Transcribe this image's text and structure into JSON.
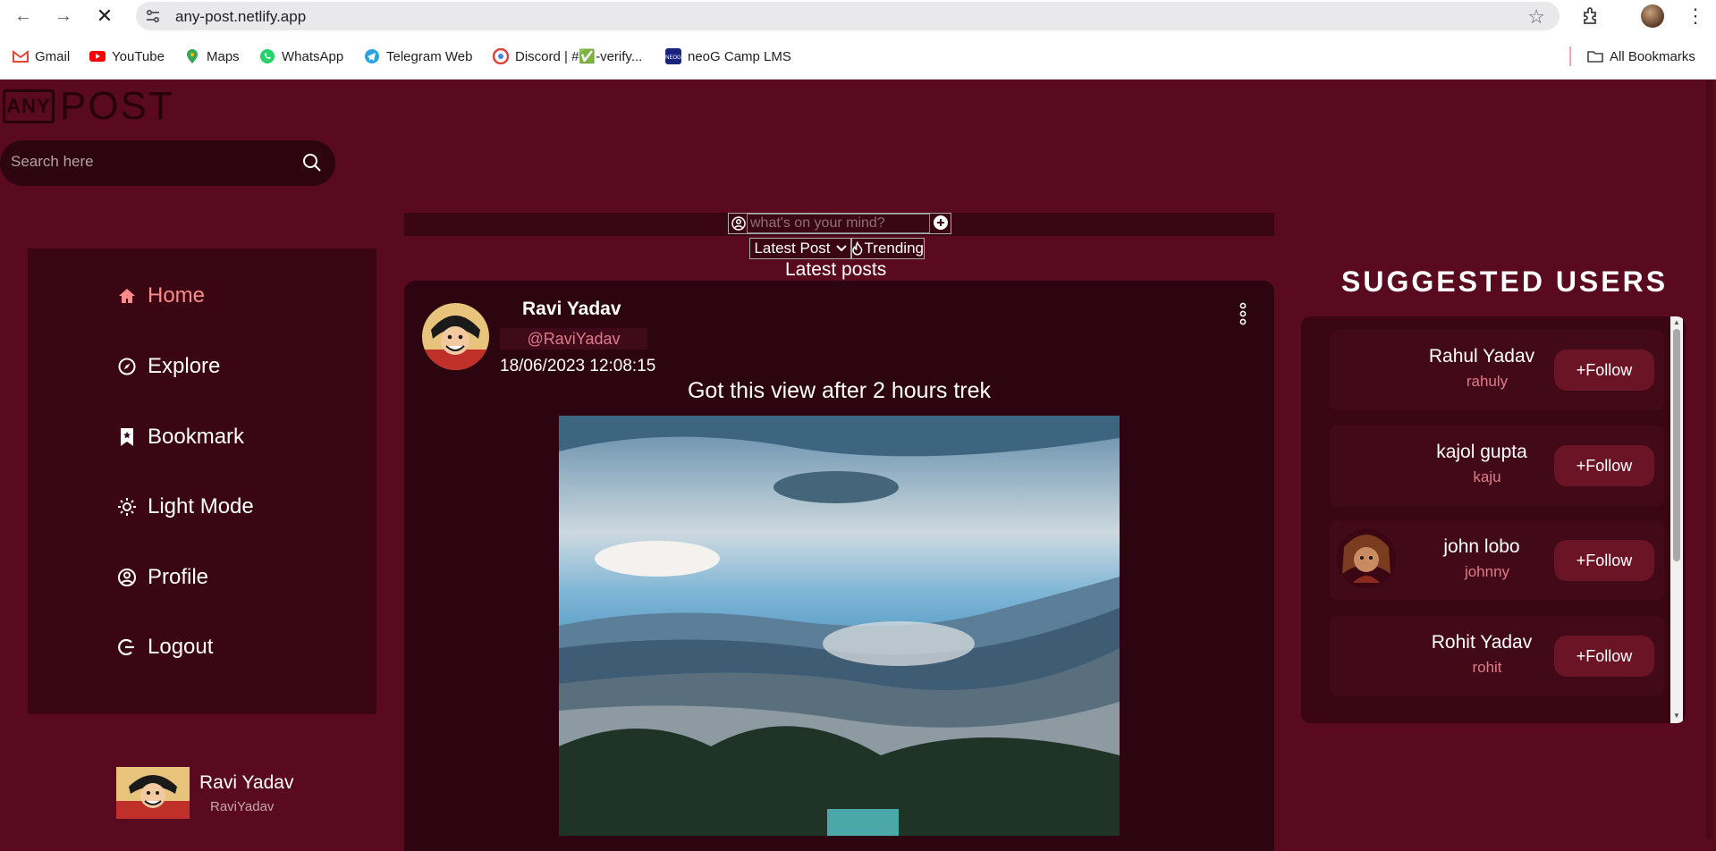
{
  "browser": {
    "url": "any-post.netlify.app",
    "bookmarks": [
      {
        "label": "Gmail",
        "icon": "gmail-icon",
        "color": "#ea4335"
      },
      {
        "label": "YouTube",
        "icon": "youtube-icon",
        "color": "#ff0000"
      },
      {
        "label": "Maps",
        "icon": "maps-icon",
        "color": "#34a853"
      },
      {
        "label": "WhatsApp",
        "icon": "whatsapp-icon",
        "color": "#25d366"
      },
      {
        "label": "Telegram Web",
        "icon": "telegram-icon",
        "color": "#2aa3df"
      },
      {
        "label": "Discord | #✅-verify...",
        "icon": "discord-icon",
        "color": "#5865f2"
      },
      {
        "label": "neoG Camp LMS",
        "icon": "neog-icon",
        "color": "#1a237e"
      }
    ],
    "all_bookmarks": "All Bookmarks"
  },
  "app": {
    "logo_box": "ANY",
    "logo_text": "POST",
    "search_placeholder": "Search here",
    "colors": {
      "background": "#5a0a1e",
      "panel": "#3a0613",
      "card": "#2c0510",
      "accent": "#ff8a8a"
    }
  },
  "sidebar": {
    "items": [
      {
        "label": "Home",
        "icon": "home-icon",
        "active": true
      },
      {
        "label": "Explore",
        "icon": "compass-icon",
        "active": false
      },
      {
        "label": "Bookmark",
        "icon": "bookmark-icon",
        "active": false
      },
      {
        "label": "Light Mode",
        "icon": "sun-icon",
        "active": false
      },
      {
        "label": "Profile",
        "icon": "user-icon",
        "active": false
      },
      {
        "label": "Logout",
        "icon": "logout-icon",
        "active": false
      }
    ],
    "user": {
      "name": "Ravi Yadav",
      "handle": "RaviYadav"
    }
  },
  "composer": {
    "placeholder": "what's on your mind?"
  },
  "filters": {
    "sort_selected": "Latest Post",
    "trending": "Trending"
  },
  "feed": {
    "title": "Latest posts",
    "posts": [
      {
        "name": "Ravi Yadav",
        "handle": "@RaviYadav",
        "time": "18/06/2023 12:08:15",
        "text": "Got this view after 2 hours trek"
      }
    ]
  },
  "suggested": {
    "title": "SUGGESTED USERS",
    "follow_label": "+Follow",
    "users": [
      {
        "name": "Rahul Yadav",
        "handle": "rahuly",
        "has_avatar": false
      },
      {
        "name": "kajol gupta",
        "handle": "kaju",
        "has_avatar": false
      },
      {
        "name": "john lobo",
        "handle": "johnny",
        "has_avatar": true
      },
      {
        "name": "Rohit Yadav",
        "handle": "rohit",
        "has_avatar": false
      }
    ]
  }
}
